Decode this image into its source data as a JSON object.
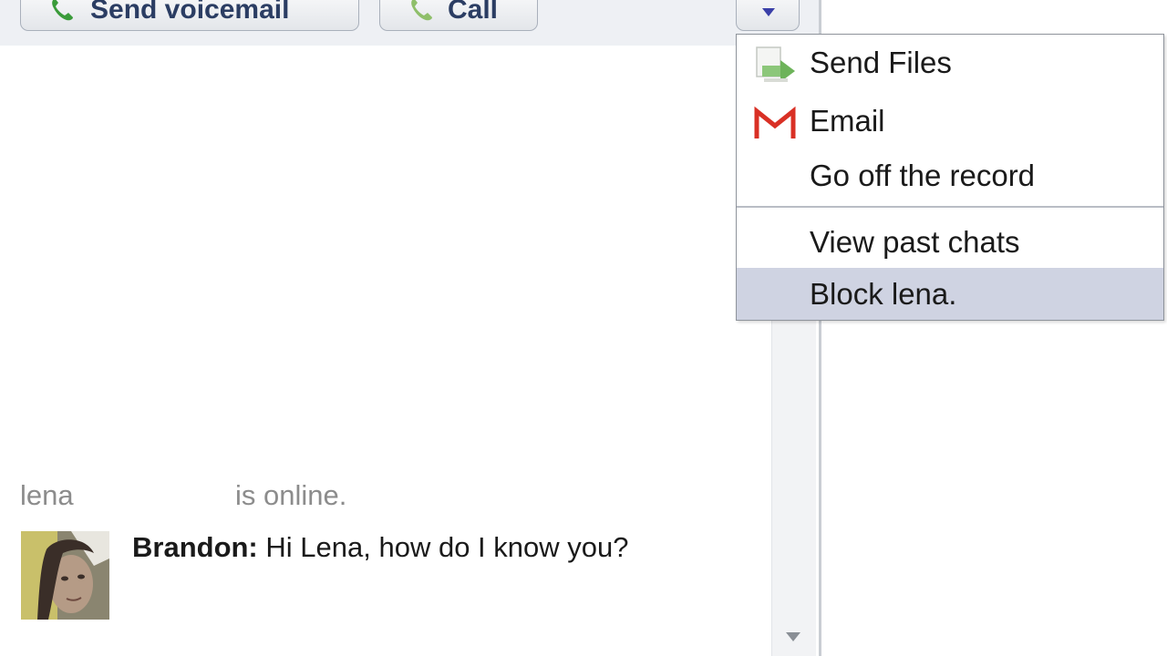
{
  "toolbar": {
    "send_voicemail_label": "Send voicemail",
    "call_label": "Call",
    "more_icon": "chevron-down-icon"
  },
  "menu": {
    "items": [
      {
        "label": "Send Files",
        "icon": "send-files-icon"
      },
      {
        "label": "Email",
        "icon": "gmail-icon"
      },
      {
        "label": "Go off the record"
      },
      {
        "label": "View past chats"
      },
      {
        "label": "Block lena."
      }
    ],
    "highlighted_item": "Block lena."
  },
  "chat": {
    "status_name": "lena",
    "status_text": "is online.",
    "messages": [
      {
        "sender": "Brandon:",
        "text": "Hi Lena, how do I know you?"
      }
    ]
  },
  "colors": {
    "button_text": "#2b3d63",
    "highlight": "#cfd3e2",
    "status_text": "#8c8c8c",
    "phone_green": "#3a9b3a",
    "gmail_red": "#d93025"
  }
}
